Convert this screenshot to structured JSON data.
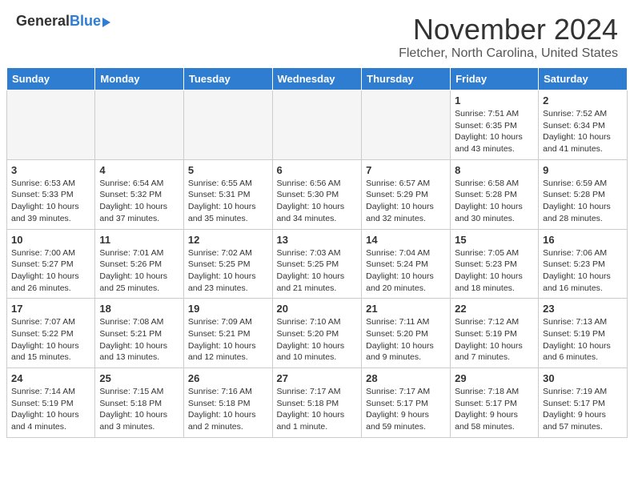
{
  "header": {
    "logo_general": "General",
    "logo_blue": "Blue",
    "month_title": "November 2024",
    "location": "Fletcher, North Carolina, United States"
  },
  "days_of_week": [
    "Sunday",
    "Monday",
    "Tuesday",
    "Wednesday",
    "Thursday",
    "Friday",
    "Saturday"
  ],
  "weeks": [
    [
      {
        "day": "",
        "info": "",
        "empty": true
      },
      {
        "day": "",
        "info": "",
        "empty": true
      },
      {
        "day": "",
        "info": "",
        "empty": true
      },
      {
        "day": "",
        "info": "",
        "empty": true
      },
      {
        "day": "",
        "info": "",
        "empty": true
      },
      {
        "day": "1",
        "info": "Sunrise: 7:51 AM\nSunset: 6:35 PM\nDaylight: 10 hours\nand 43 minutes."
      },
      {
        "day": "2",
        "info": "Sunrise: 7:52 AM\nSunset: 6:34 PM\nDaylight: 10 hours\nand 41 minutes."
      }
    ],
    [
      {
        "day": "3",
        "info": "Sunrise: 6:53 AM\nSunset: 5:33 PM\nDaylight: 10 hours\nand 39 minutes."
      },
      {
        "day": "4",
        "info": "Sunrise: 6:54 AM\nSunset: 5:32 PM\nDaylight: 10 hours\nand 37 minutes."
      },
      {
        "day": "5",
        "info": "Sunrise: 6:55 AM\nSunset: 5:31 PM\nDaylight: 10 hours\nand 35 minutes."
      },
      {
        "day": "6",
        "info": "Sunrise: 6:56 AM\nSunset: 5:30 PM\nDaylight: 10 hours\nand 34 minutes."
      },
      {
        "day": "7",
        "info": "Sunrise: 6:57 AM\nSunset: 5:29 PM\nDaylight: 10 hours\nand 32 minutes."
      },
      {
        "day": "8",
        "info": "Sunrise: 6:58 AM\nSunset: 5:28 PM\nDaylight: 10 hours\nand 30 minutes."
      },
      {
        "day": "9",
        "info": "Sunrise: 6:59 AM\nSunset: 5:28 PM\nDaylight: 10 hours\nand 28 minutes."
      }
    ],
    [
      {
        "day": "10",
        "info": "Sunrise: 7:00 AM\nSunset: 5:27 PM\nDaylight: 10 hours\nand 26 minutes."
      },
      {
        "day": "11",
        "info": "Sunrise: 7:01 AM\nSunset: 5:26 PM\nDaylight: 10 hours\nand 25 minutes."
      },
      {
        "day": "12",
        "info": "Sunrise: 7:02 AM\nSunset: 5:25 PM\nDaylight: 10 hours\nand 23 minutes."
      },
      {
        "day": "13",
        "info": "Sunrise: 7:03 AM\nSunset: 5:25 PM\nDaylight: 10 hours\nand 21 minutes."
      },
      {
        "day": "14",
        "info": "Sunrise: 7:04 AM\nSunset: 5:24 PM\nDaylight: 10 hours\nand 20 minutes."
      },
      {
        "day": "15",
        "info": "Sunrise: 7:05 AM\nSunset: 5:23 PM\nDaylight: 10 hours\nand 18 minutes."
      },
      {
        "day": "16",
        "info": "Sunrise: 7:06 AM\nSunset: 5:23 PM\nDaylight: 10 hours\nand 16 minutes."
      }
    ],
    [
      {
        "day": "17",
        "info": "Sunrise: 7:07 AM\nSunset: 5:22 PM\nDaylight: 10 hours\nand 15 minutes."
      },
      {
        "day": "18",
        "info": "Sunrise: 7:08 AM\nSunset: 5:21 PM\nDaylight: 10 hours\nand 13 minutes."
      },
      {
        "day": "19",
        "info": "Sunrise: 7:09 AM\nSunset: 5:21 PM\nDaylight: 10 hours\nand 12 minutes."
      },
      {
        "day": "20",
        "info": "Sunrise: 7:10 AM\nSunset: 5:20 PM\nDaylight: 10 hours\nand 10 minutes."
      },
      {
        "day": "21",
        "info": "Sunrise: 7:11 AM\nSunset: 5:20 PM\nDaylight: 10 hours\nand 9 minutes."
      },
      {
        "day": "22",
        "info": "Sunrise: 7:12 AM\nSunset: 5:19 PM\nDaylight: 10 hours\nand 7 minutes."
      },
      {
        "day": "23",
        "info": "Sunrise: 7:13 AM\nSunset: 5:19 PM\nDaylight: 10 hours\nand 6 minutes."
      }
    ],
    [
      {
        "day": "24",
        "info": "Sunrise: 7:14 AM\nSunset: 5:19 PM\nDaylight: 10 hours\nand 4 minutes."
      },
      {
        "day": "25",
        "info": "Sunrise: 7:15 AM\nSunset: 5:18 PM\nDaylight: 10 hours\nand 3 minutes."
      },
      {
        "day": "26",
        "info": "Sunrise: 7:16 AM\nSunset: 5:18 PM\nDaylight: 10 hours\nand 2 minutes."
      },
      {
        "day": "27",
        "info": "Sunrise: 7:17 AM\nSunset: 5:18 PM\nDaylight: 10 hours\nand 1 minute."
      },
      {
        "day": "28",
        "info": "Sunrise: 7:17 AM\nSunset: 5:17 PM\nDaylight: 9 hours\nand 59 minutes."
      },
      {
        "day": "29",
        "info": "Sunrise: 7:18 AM\nSunset: 5:17 PM\nDaylight: 9 hours\nand 58 minutes."
      },
      {
        "day": "30",
        "info": "Sunrise: 7:19 AM\nSunset: 5:17 PM\nDaylight: 9 hours\nand 57 minutes."
      }
    ]
  ]
}
